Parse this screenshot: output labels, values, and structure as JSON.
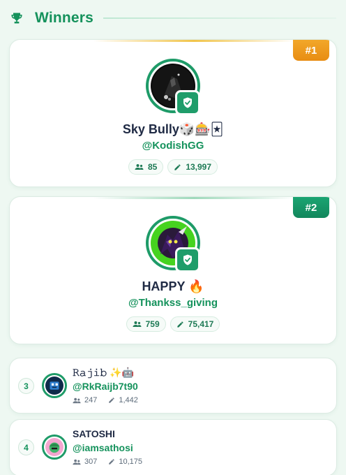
{
  "header": {
    "title": "Winners",
    "icon": "trophy-icon"
  },
  "colors": {
    "accent": "#15925c",
    "gold": "#e88d12",
    "green_badge": "#12875c"
  },
  "winners_top": [
    {
      "rank_label": "#1",
      "name": "Sky Bully🎲🎰🃏",
      "handle": "@KodishGG",
      "followers": "85",
      "posts": "13,997"
    },
    {
      "rank_label": "#2",
      "name": "HAPPY 🔥",
      "handle": "@Thankss_giving",
      "followers": "759",
      "posts": "75,417"
    }
  ],
  "winners_list": [
    {
      "rank": "3",
      "name": "𝚁𝚊𝚓𝚒𝚋 ✨🤖",
      "handle": "@RkRaijb7t90",
      "followers": "247",
      "posts": "1,442"
    },
    {
      "rank": "4",
      "name": "SATOSHI",
      "handle": "@iamsathosi",
      "followers": "307",
      "posts": "10,175"
    }
  ]
}
